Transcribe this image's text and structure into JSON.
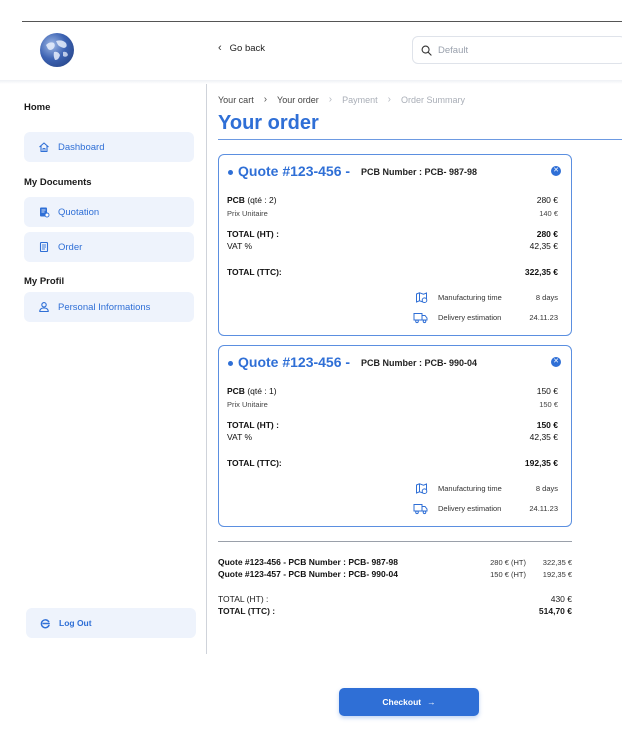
{
  "header": {
    "go_back_label": "Go back",
    "search_placeholder": "Default"
  },
  "sidebar": {
    "sections": [
      {
        "title": "Home",
        "items": [
          {
            "label": "Dashboard",
            "icon": "home-icon"
          }
        ]
      },
      {
        "title": "My Documents",
        "items": [
          {
            "label": "Quotation",
            "icon": "quotation-icon"
          },
          {
            "label": "Order",
            "icon": "order-icon"
          }
        ]
      },
      {
        "title": "My Profil",
        "items": [
          {
            "label": "Personal Informations",
            "icon": "user-icon"
          }
        ]
      }
    ],
    "logout_label": "Log Out"
  },
  "breadcrumb": [
    "Your cart",
    "Your order",
    "Payment",
    "Order Summary"
  ],
  "page_title": "Your order",
  "quotes": [
    {
      "quote_number": "Quote #123-456 -",
      "pcb_number": "PCB Number : PCB- 987-98",
      "pcb_label": "PCB",
      "qty": "(qté : 2)",
      "pcb_price": "280 €",
      "unit_label": "Prix Unitaire",
      "unit_price": "140 €",
      "total_ht_label": "TOTAL (HT) :",
      "total_ht": "280  €",
      "vat_label": "VAT %",
      "vat": "42,35 €",
      "total_ttc_label": "TOTAL  (TTC):",
      "total_ttc": "322,35 €",
      "manufacturing_label": "Manufacturing time",
      "manufacturing_value": "8 days",
      "delivery_label": "Delivery estimation",
      "delivery_value": "24.11.23"
    },
    {
      "quote_number": "Quote #123-456 -",
      "pcb_number": "PCB Number : PCB- 990-04",
      "pcb_label": "PCB",
      "qty": "(qté : 1)",
      "pcb_price": "150 €",
      "unit_label": "Prix Unitaire",
      "unit_price": "150 €",
      "total_ht_label": "TOTAL (HT) :",
      "total_ht": "150  €",
      "vat_label": "VAT %",
      "vat": "42,35 €",
      "total_ttc_label": "TOTAL  (TTC):",
      "total_ttc": "192,35 €",
      "manufacturing_label": "Manufacturing time",
      "manufacturing_value": "8 days",
      "delivery_label": "Delivery estimation",
      "delivery_value": "24.11.23"
    }
  ],
  "summary": {
    "lines": [
      {
        "label": "Quote #123-456 - PCB Number : PCB- 987-98",
        "ht": "280 € (HT)",
        "ttc": "322,35 €"
      },
      {
        "label": "Quote #123-457 - PCB Number : PCB- 990-04",
        "ht": "150 € (HT)",
        "ttc": "192,35 €"
      }
    ],
    "total_ht_label": "TOTAL (HT)  :",
    "total_ht": "430 €",
    "total_ttc_label": "TOTAL  (TTC) :",
    "total_ttc": "514,70 €"
  },
  "checkout_label": "Checkout",
  "colors": {
    "accent": "#2f6fd6",
    "sidebar_item_bg": "#eef3fc"
  }
}
